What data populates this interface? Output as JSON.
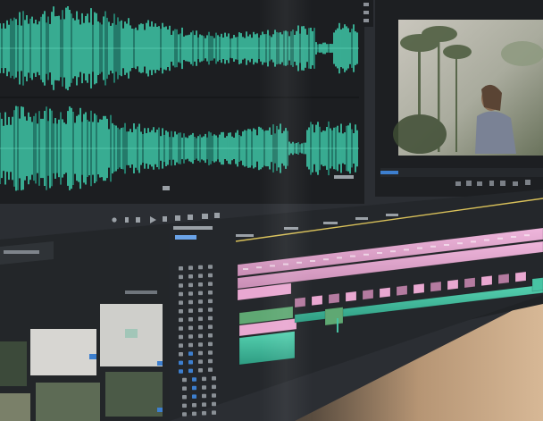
{
  "scene": {
    "description_free": true,
    "colors": {
      "app_background": "#2b2e33",
      "panel_background": "#1e2023",
      "waveform": "#3fcfae",
      "waveform_dim": "#27927c",
      "clip_pink": "#e9a8d1",
      "clip_pink_dark": "#b47ba0",
      "clip_teal": "#47c3a3",
      "clip_green": "#5fa873",
      "playhead": "#d9c15a",
      "ui_blue": "#3d7fcf",
      "desk_wood": "#c8a783",
      "monitor_bezel": "#26292c"
    },
    "icons": [
      "play-icon",
      "step-back-icon",
      "step-forward-icon",
      "mark-in-icon",
      "mark-out-icon",
      "lift-icon",
      "extract-icon",
      "camera-icon",
      "track-lock-icon",
      "track-eye-icon",
      "track-mute-icon"
    ]
  }
}
